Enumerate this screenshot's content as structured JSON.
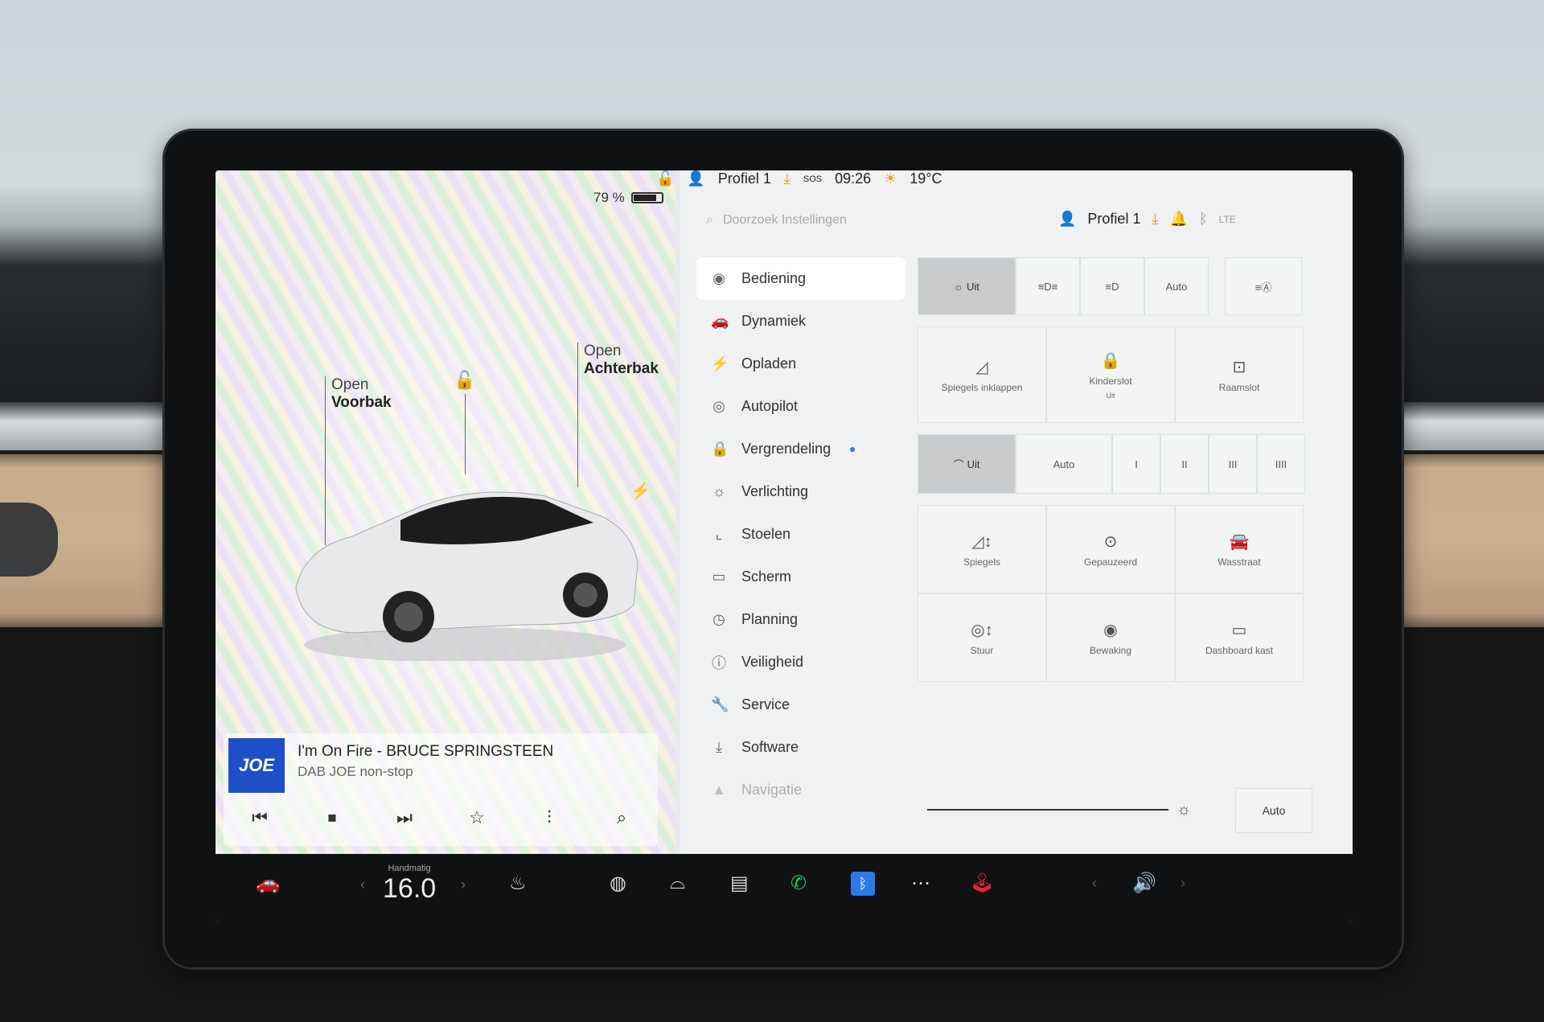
{
  "status": {
    "battery": "79 %",
    "profile": "Profiel 1",
    "sos": "SOS",
    "time": "09:26",
    "temp": "19°C"
  },
  "car": {
    "label_front_open": "Open",
    "label_front": "Voorbak",
    "label_rear_open": "Open",
    "label_rear": "Achterbak"
  },
  "media": {
    "logo": "JOE",
    "track": "I'm On Fire - BRUCE SPRINGSTEEN",
    "station": "DAB JOE non-stop"
  },
  "settings": {
    "search_placeholder": "Doorzoek Instellingen",
    "profile": "Profiel 1",
    "menu": [
      {
        "label": "Bediening",
        "icon": "toggle-icon"
      },
      {
        "label": "Dynamiek",
        "icon": "car-icon"
      },
      {
        "label": "Opladen",
        "icon": "bolt-icon"
      },
      {
        "label": "Autopilot",
        "icon": "steering-icon"
      },
      {
        "label": "Vergrendeling",
        "icon": "lock-icon"
      },
      {
        "label": "Verlichting",
        "icon": "sun-icon"
      },
      {
        "label": "Stoelen",
        "icon": "seat-icon"
      },
      {
        "label": "Scherm",
        "icon": "screen-icon"
      },
      {
        "label": "Planning",
        "icon": "clock-icon"
      },
      {
        "label": "Veiligheid",
        "icon": "alert-icon"
      },
      {
        "label": "Service",
        "icon": "wrench-icon"
      },
      {
        "label": "Software",
        "icon": "download-icon"
      },
      {
        "label": "Navigatie",
        "icon": "nav-icon"
      }
    ],
    "lights": {
      "off": "Uit",
      "auto": "Auto"
    },
    "tiles1": {
      "mirrors_fold": "Spiegels inklappen",
      "childlock": "Kinderslot",
      "childlock_sub": "Uit",
      "windowlock": "Raamslot"
    },
    "wipers": {
      "off": "Uit",
      "auto": "Auto",
      "l1": "I",
      "l2": "II",
      "l3": "III",
      "l4": "IIII"
    },
    "tiles2": {
      "mirrors": "Spiegels",
      "paused": "Gepauzeerd",
      "carwash": "Wasstraat",
      "steering": "Stuur",
      "sentry": "Bewaking",
      "glovebox": "Dashboard kast"
    },
    "brightness_auto": "Auto"
  },
  "dock": {
    "temp_mode": "Handmatig",
    "temp_value": "16.0"
  }
}
